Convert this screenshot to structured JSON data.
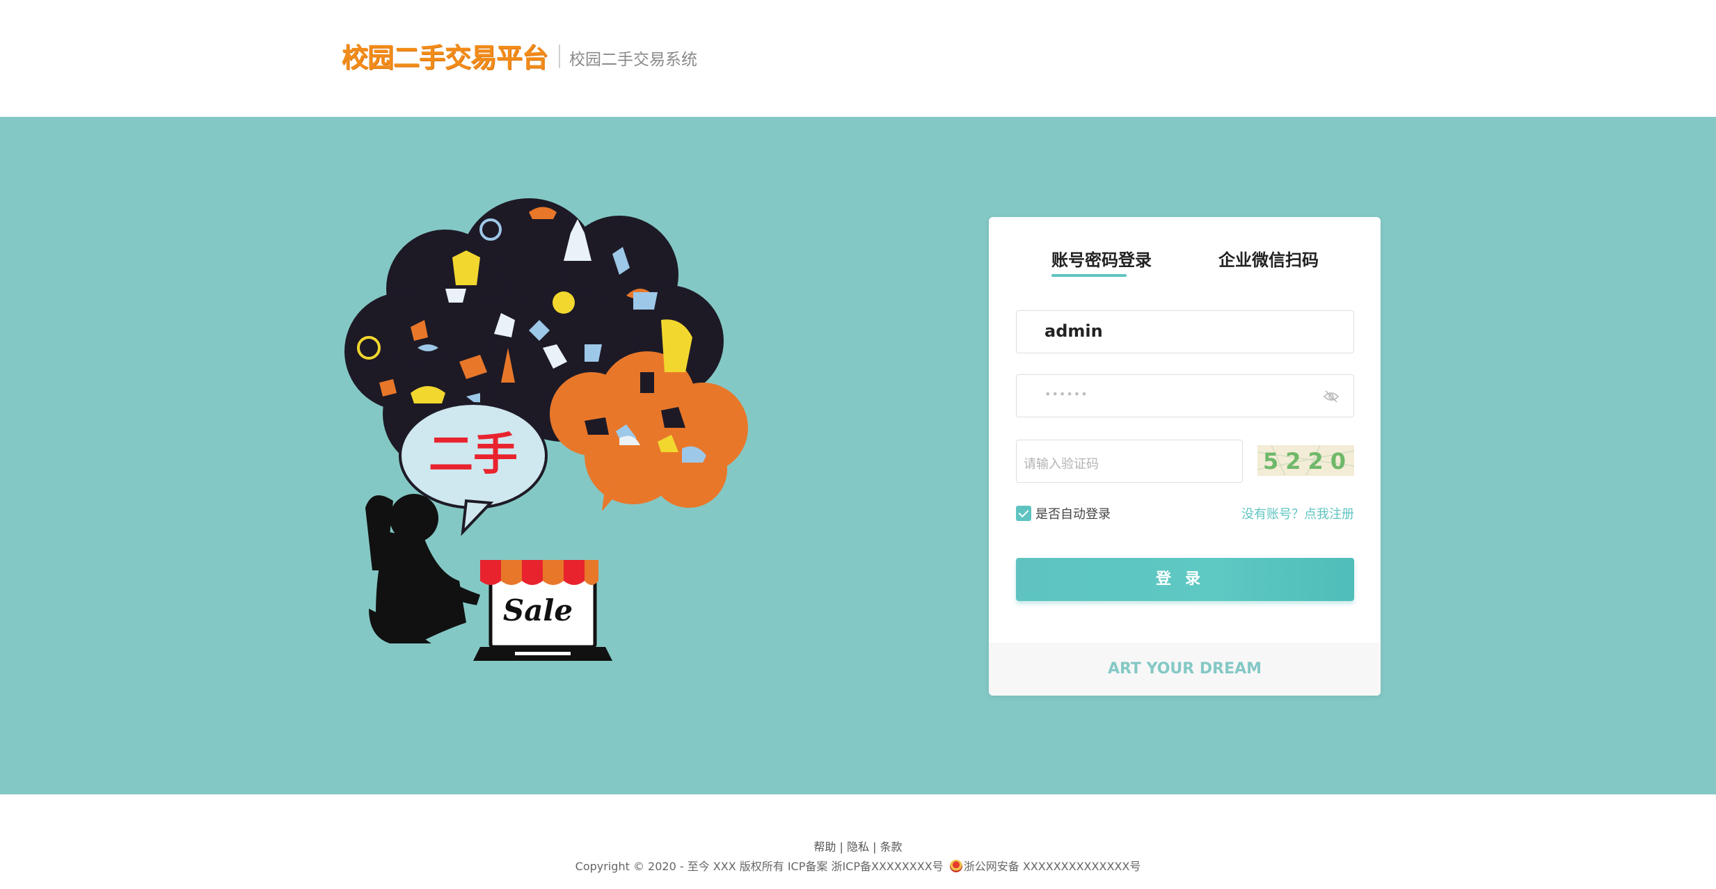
{
  "header": {
    "logo_text": "校园二手交易平台",
    "subtitle": "校园二手交易系统"
  },
  "illustration": {
    "bubble_text": "二手",
    "laptop_text": "Sale"
  },
  "login": {
    "tabs": [
      {
        "label": "账号密码登录",
        "active": true
      },
      {
        "label": "企业微信扫码",
        "active": false
      }
    ],
    "username_value": "admin",
    "password_mask": "••••••",
    "captcha_placeholder": "请输入验证码",
    "captcha_code": "5220",
    "auto_login_label": "是否自动登录",
    "auto_login_checked": true,
    "register_link": "没有账号？点我注册",
    "login_button": "登录",
    "footer_slogan": "ART YOUR DREAM"
  },
  "footer": {
    "links": "帮助 | 隐私 | 条款",
    "copyright_left": "Copyright © 2020 - 至今 XXX 版权所有 ICP备案 浙ICP备XXXXXXXX号",
    "copyright_right": "浙公网安备 XXXXXXXXXXXXXX号"
  },
  "colors": {
    "accent": "#5fc4c1",
    "banner_bg": "#84c8c5",
    "logo": "#f28c1a"
  }
}
